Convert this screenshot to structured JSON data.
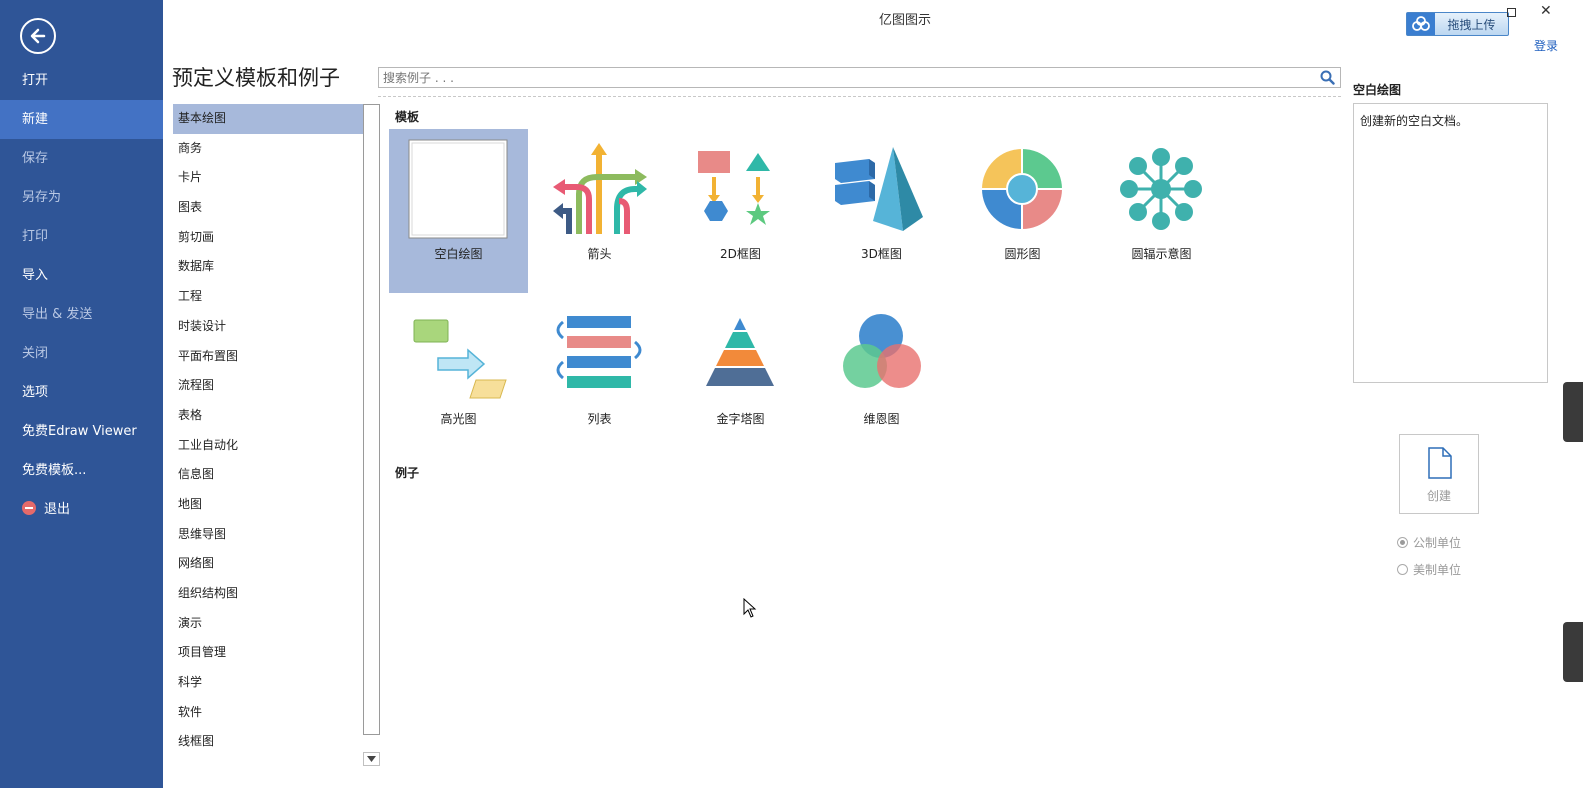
{
  "window": {
    "title": "亿图图示"
  },
  "top": {
    "upload_label": "拖拽上传",
    "login": "登录",
    "close": "✕"
  },
  "nav": {
    "items": [
      {
        "label": "打开"
      },
      {
        "label": "新建"
      },
      {
        "label": "保存"
      },
      {
        "label": "另存为"
      },
      {
        "label": "打印"
      },
      {
        "label": "导入"
      },
      {
        "label": "导出 & 发送"
      },
      {
        "label": "关闭"
      },
      {
        "label": "选项"
      },
      {
        "label": "免费Edraw Viewer"
      },
      {
        "label": "免费模板..."
      },
      {
        "label": "退出"
      }
    ]
  },
  "main": {
    "title": "预定义模板和例子",
    "search_placeholder": "搜索例子 . . .",
    "categories": [
      "基本绘图",
      "商务",
      "卡片",
      "图表",
      "剪切画",
      "数据库",
      "工程",
      "时装设计",
      "平面布置图",
      "流程图",
      "表格",
      "工业自动化",
      "信息图",
      "地图",
      "思维导图",
      "网络图",
      "组织结构图",
      "演示",
      "项目管理",
      "科学",
      "软件",
      "线框图"
    ],
    "templates_heading": "模板",
    "templates": [
      "空白绘图",
      "箭头",
      "2D框图",
      "3D框图",
      "圆形图",
      "圆辐示意图",
      "高光图",
      "列表",
      "金字塔图",
      "维恩图"
    ],
    "examples_heading": "例子"
  },
  "right_panel": {
    "title": "空白绘图",
    "description": "创建新的空白文档。",
    "create_label": "创建",
    "units": [
      {
        "label": "公制单位",
        "selected": true
      },
      {
        "label": "美制单位",
        "selected": false
      }
    ]
  }
}
